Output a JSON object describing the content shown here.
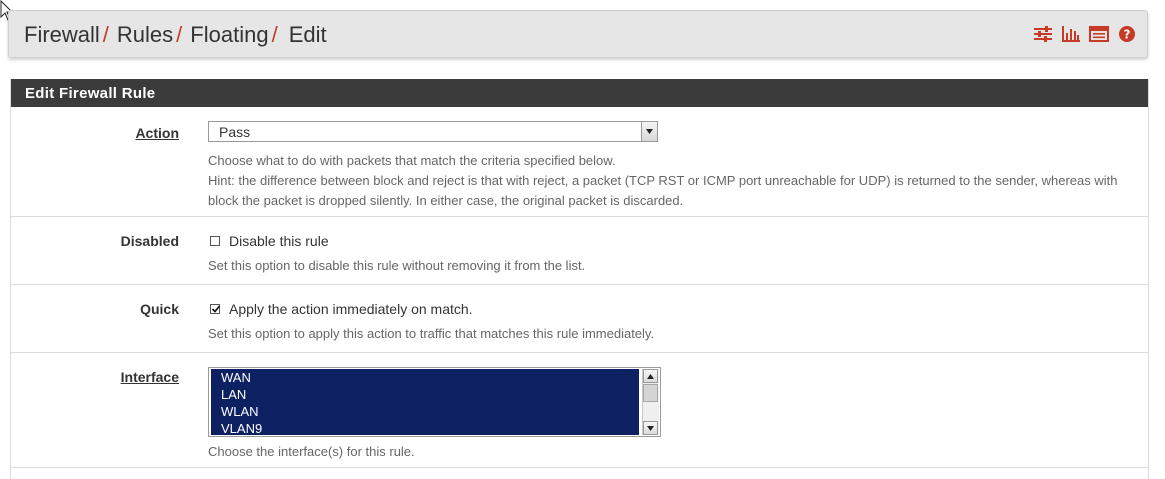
{
  "breadcrumb": {
    "items": [
      "Firewall",
      "Rules",
      "Floating",
      "Edit"
    ],
    "separator": "/"
  },
  "shortcut_icons": [
    "sliders-icon",
    "bar-chart-icon",
    "log-table-icon",
    "help-icon"
  ],
  "panel": {
    "title": "Edit Firewall Rule"
  },
  "fields": {
    "action": {
      "label": "Action",
      "value": "Pass",
      "help_line1": "Choose what to do with packets that match the criteria specified below.",
      "help_line2": "Hint: the difference between block and reject is that with reject, a packet (TCP RST or ICMP port unreachable for UDP) is returned to the sender, whereas with block the packet is dropped silently. In either case, the original packet is discarded."
    },
    "disabled": {
      "label": "Disabled",
      "checkbox_label": "Disable this rule",
      "checked": false,
      "help": "Set this option to disable this rule without removing it from the list."
    },
    "quick": {
      "label": "Quick",
      "checkbox_label": "Apply the action immediately on match.",
      "checked": true,
      "help": "Set this option to apply this action to traffic that matches this rule immediately."
    },
    "interface": {
      "label": "Interface",
      "options": [
        "WAN",
        "LAN",
        "WLAN",
        "VLAN9"
      ],
      "help": "Choose the interface(s) for this rule."
    }
  },
  "colors": {
    "accent": "#c73a26",
    "panel_heading_bg": "#3b3b3b",
    "listbox_selected_bg": "#0d2162"
  }
}
